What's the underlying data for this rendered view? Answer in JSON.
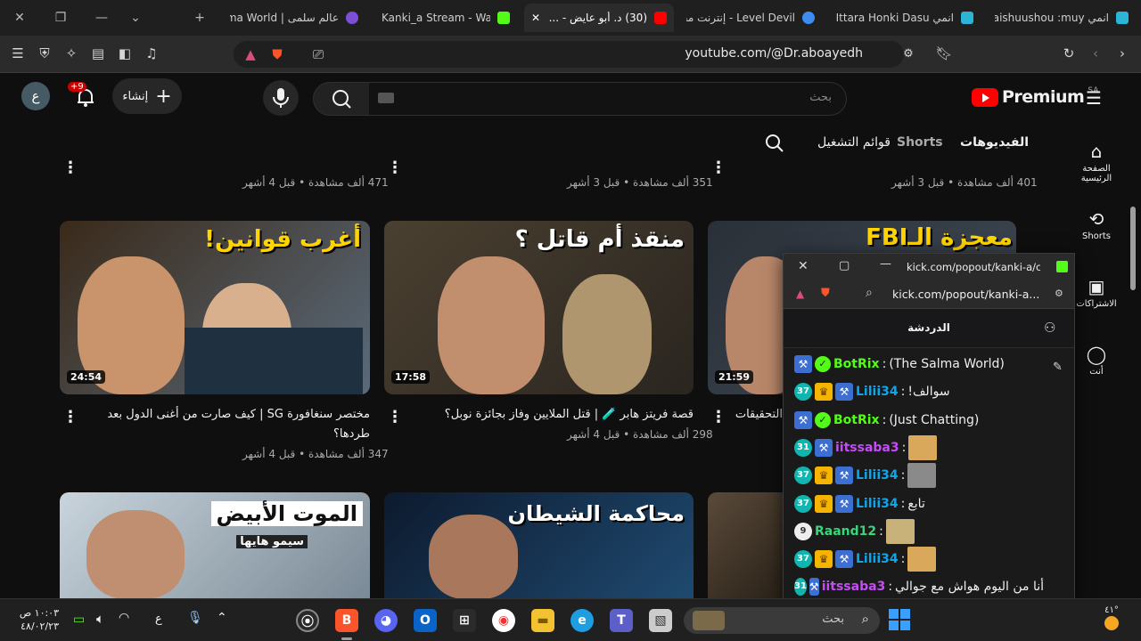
{
  "browser": {
    "tabs": [
      {
        "title": "عالم سلمى | Salma World",
        "favicon_color": "#7b4fd6"
      },
      {
        "title": "Kanki_a Stream - Watch",
        "favicon_color": "#53fc18"
      },
      {
        "title": "(30) د. أبو عايض - ...",
        "favicon_color": "#ff0000",
        "active": true
      },
      {
        "title": "Level Devil - إنترنت مجانًا",
        "favicon_color": "#3b8ef0"
      },
      {
        "title": "انمي Ittara Honki Dasu",
        "favicon_color": "#2bb5d6"
      },
      {
        "title": "انمي Saishuushou :muy",
        "favicon_color": "#2bb5d6"
      }
    ],
    "url": "youtube.com/@Dr.aboayedh",
    "icons": [
      "close-icon",
      "restore-icon",
      "minimize-icon",
      "chevron-down-icon",
      "new-tab-icon",
      "menu-icon",
      "shield-icon",
      "extensions-icon",
      "sidebar-icon",
      "reader-icon",
      "music-icon",
      "brave-rewards-icon",
      "brave-shields-icon",
      "screen-cast-icon",
      "share-icon",
      "bookmark-icon",
      "reload-icon",
      "back-icon",
      "forward-icon"
    ]
  },
  "youtube": {
    "logo_text": "Premium",
    "logo_region": "SA",
    "search_placeholder": "بحث",
    "create_label": "إنشاء",
    "notification_badge": "+9",
    "avatar_letter": "ع",
    "nav": [
      {
        "label": "الصفحة الرئيسية",
        "icon": "home-icon"
      },
      {
        "label": "Shorts",
        "icon": "shorts-icon"
      },
      {
        "label": "الاشتراكات",
        "icon": "subscriptions-icon"
      },
      {
        "label": "أنت",
        "icon": "you-icon"
      }
    ],
    "channel_tabs": {
      "videos": "الفيديوهات",
      "shorts": "Shorts",
      "playlists": "قوائم التشغيل"
    },
    "top_row_meta": [
      "471 ألف مشاهدة • قبل 4 أشهر",
      "351 ألف مشاهدة • قبل 3 أشهر",
      "401 ألف مشاهدة • قبل 3 أشهر"
    ],
    "videos": [
      {
        "thumb_text": "أغرب قوانين!",
        "duration": "24:54",
        "title": "مختصر سنغافورة SG | كيف صارت من أغنى الدول بعد طردها؟",
        "meta": "347 ألف مشاهدة • قبل 4 أشهر"
      },
      {
        "thumb_text": "منقذ أم قاتل ؟",
        "duration": "17:58",
        "title": "قصة فريتز هابر 🧪 | قتل الملايين وفاز بجائزة نوبل؟",
        "meta": "298 ألف مشاهدة • قبل 4 أشهر"
      },
      {
        "thumb_text": "معجزة الـFBI",
        "duration": "21:59",
        "title": "التحقيقات",
        "meta": ""
      }
    ],
    "bottom_row": [
      {
        "thumb_text": "الموت الأبيض",
        "sub_text": "سيمو هايها"
      },
      {
        "thumb_text": "محاكمة الشيطان"
      },
      {
        "thumb_text": ""
      }
    ]
  },
  "popup": {
    "title": "kick.com/popout/kanki-a/cha...",
    "url": "kick.com/popout/kanki-a...",
    "chat_header": "الدردشة",
    "messages": [
      {
        "badges": [
          "tool",
          "verified"
        ],
        "user": "BotRix",
        "user_color": "#53fc18",
        "text": "(The Salma World)"
      },
      {
        "badges": [
          "37",
          "crown",
          "tool"
        ],
        "user": "Lilii34",
        "user_color": "#0ea5e9",
        "text": "سوالف!"
      },
      {
        "badges": [
          "tool",
          "verified"
        ],
        "user": "BotRix",
        "user_color": "#53fc18",
        "text": "(Just Chatting)"
      },
      {
        "badges": [
          "31",
          "tool"
        ],
        "user": "iitssaba3",
        "user_color": "#c44df3",
        "text": "",
        "emote": true
      },
      {
        "badges": [
          "37",
          "crown",
          "tool"
        ],
        "user": "Lilii34",
        "user_color": "#0ea5e9",
        "text": "",
        "emote": true
      },
      {
        "badges": [
          "37",
          "crown",
          "tool"
        ],
        "user": "Lilii34",
        "user_color": "#0ea5e9",
        "text": "تابع"
      },
      {
        "badges": [
          "9"
        ],
        "user": "Raand12",
        "user_color": "#37d67a",
        "text": "",
        "emote": true
      },
      {
        "badges": [
          "37",
          "crown",
          "tool"
        ],
        "user": "Lilii34",
        "user_color": "#0ea5e9",
        "text": "",
        "emote": true
      },
      {
        "badges": [
          "31",
          "tool"
        ],
        "user": "iitssaba3",
        "user_color": "#c44df3",
        "text": "أنا من اليوم هواش مع جوالي"
      }
    ]
  },
  "taskbar": {
    "time": "١٠:٠٣ ص",
    "date": "٤٨/٠٢/٢٣",
    "lang": "ع",
    "search_placeholder": "بحث",
    "temp": "٤١°"
  }
}
